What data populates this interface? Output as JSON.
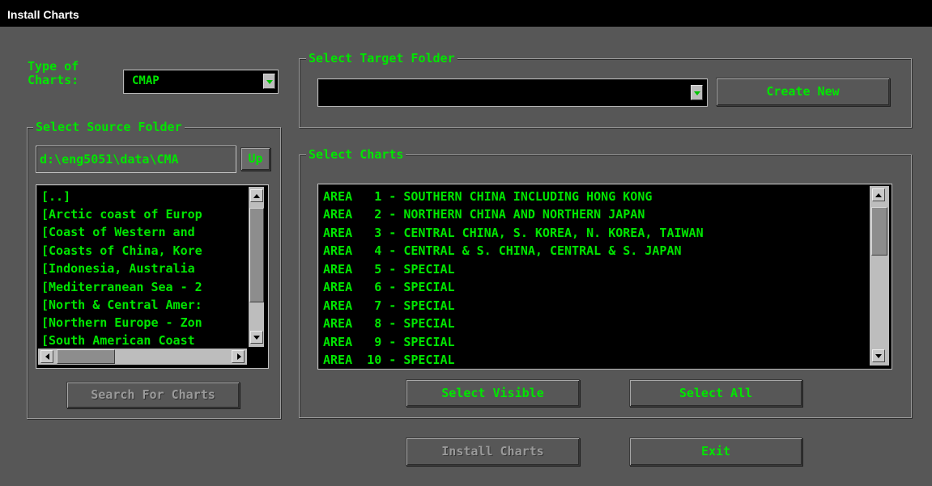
{
  "window": {
    "title": "Install Charts"
  },
  "type_of_charts": {
    "label_line1": "Type of",
    "label_line2": "Charts:",
    "value": "CMAP"
  },
  "source_folder": {
    "legend": "Select Source Folder",
    "path": "d:\\eng5051\\data\\CMA",
    "up_label": "Up",
    "items": [
      "[..]",
      "[Arctic coast of Europ",
      "[Coast of Western and",
      "[Coasts of China, Kore",
      "[Indonesia, Australia",
      "[Mediterranean Sea - 2",
      "[North & Central Amer:",
      "[Northern Europe - Zon",
      "[South American Coast"
    ],
    "search_label": "Search For Charts"
  },
  "target_folder": {
    "legend": "Select Target Folder",
    "value": "",
    "create_label": "Create New"
  },
  "charts": {
    "legend": "Select Charts",
    "items": [
      "AREA   1 - SOUTHERN CHINA INCLUDING HONG KONG",
      "AREA   2 - NORTHERN CHINA AND NORTHERN JAPAN",
      "AREA   3 - CENTRAL CHINA, S. KOREA, N. KOREA, TAIWAN",
      "AREA   4 - CENTRAL & S. CHINA, CENTRAL & S. JAPAN",
      "AREA   5 - SPECIAL",
      "AREA   6 - SPECIAL",
      "AREA   7 - SPECIAL",
      "AREA   8 - SPECIAL",
      "AREA   9 - SPECIAL",
      "AREA  10 - SPECIAL"
    ],
    "select_visible_label": "Select Visible",
    "select_all_label": "Select All"
  },
  "footer": {
    "install_label": "Install Charts",
    "exit_label": "Exit"
  },
  "colors": {
    "text": "#00e600",
    "background": "#575757",
    "list_bg": "#000000"
  }
}
